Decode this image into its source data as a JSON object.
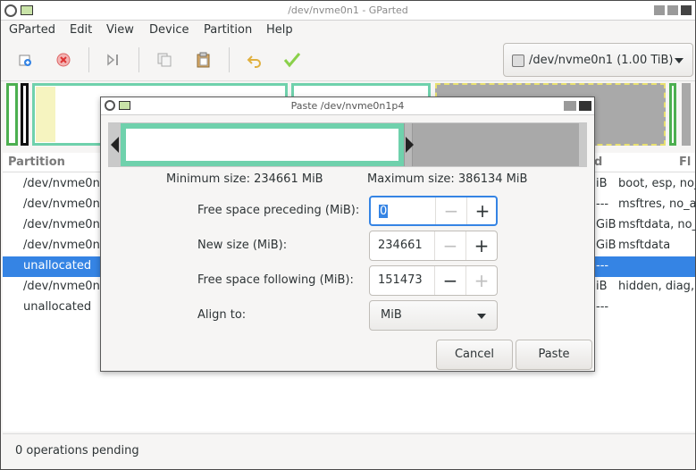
{
  "window": {
    "title": "/dev/nvme0n1 - GParted"
  },
  "menu": [
    "GParted",
    "Edit",
    "View",
    "Device",
    "Partition",
    "Help"
  ],
  "device_selector": {
    "label": "/dev/nvme0n1 (1.00 TiB)"
  },
  "toolbar": {
    "icons": [
      "new-icon",
      "delete-icon",
      "resize-move-icon",
      "copy-icon",
      "paste-icon",
      "undo-icon",
      "apply-icon"
    ]
  },
  "list": {
    "headers": {
      "partition": "Partition",
      "col_d": "d",
      "col_fl": "Fl"
    },
    "rows": [
      {
        "partition": "/dev/nvme0n1",
        "size_frag": "iB",
        "flags": "boot, esp, no_"
      },
      {
        "partition": "/dev/nvme0n1",
        "size_frag": "---",
        "flags": "msftres, no_a"
      },
      {
        "partition": "/dev/nvme0n1",
        "size_frag": "GiB",
        "flags": "msftdata, no_"
      },
      {
        "partition": "/dev/nvme0n1",
        "size_frag": "GiB",
        "flags": "msftdata"
      },
      {
        "partition": "unallocated",
        "size_frag": "---",
        "flags": ""
      },
      {
        "partition": "/dev/nvme0n1",
        "size_frag": "iB",
        "flags": "hidden, diag,"
      },
      {
        "partition": "unallocated",
        "size_frag": "---",
        "flags": ""
      }
    ]
  },
  "status": {
    "text": "0 operations pending"
  },
  "dialog": {
    "title": "Paste /dev/nvme0n1p4",
    "min_size": "Minimum size: 234661 MiB",
    "max_size": "Maximum size: 386134 MiB",
    "fields": {
      "preceding_label": "Free space preceding (MiB):",
      "preceding_value": "0",
      "new_size_label": "New size (MiB):",
      "new_size_value": "234661",
      "following_label": "Free space following (MiB):",
      "following_value": "151473",
      "align_label": "Align to:",
      "align_value": "MiB"
    },
    "buttons": {
      "cancel": "Cancel",
      "paste": "Paste"
    }
  },
  "colors": {
    "accent": "#3584e4",
    "partition_fill": "#6fd1ac",
    "unallocated": "#a9a9a9"
  }
}
